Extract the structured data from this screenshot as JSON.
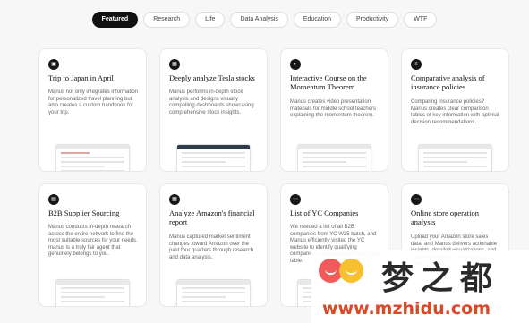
{
  "tabs": [
    {
      "label": "Featured",
      "active": true
    },
    {
      "label": "Research",
      "active": false
    },
    {
      "label": "Life",
      "active": false
    },
    {
      "label": "Data Analysis",
      "active": false
    },
    {
      "label": "Education",
      "active": false
    },
    {
      "label": "Productivity",
      "active": false
    },
    {
      "label": "WTF",
      "active": false
    }
  ],
  "cards": [
    {
      "icon": "suitcase-icon",
      "title": "Trip to Japan in April",
      "description": "Manus not only integrates information for personalized travel planning but also creates a custom handbook for your trip."
    },
    {
      "icon": "image-icon",
      "title": "Deeply analyze Tesla stocks",
      "description": "Manus performs in-depth stock analysis and designs visually compelling dashboards showcasing comprehensive stock insights."
    },
    {
      "icon": "moon-icon",
      "title": "Interactive Course on the Momentum Theorem",
      "description": "Manus creates video presentation materials for middle school teachers explaining the momentum theorem."
    },
    {
      "icon": "document-icon",
      "title": "Comparative analysis of insurance policies",
      "description": "Comparing insurance policies? Manus creates clear comparison tables of key information with optimal decision recommendations."
    },
    {
      "icon": "chart-icon",
      "title": "B2B Supplier Sourcing",
      "description": "Manus conducts in-depth research across the entire network to find the most suitable sources for your needs. manus is a truly fair agent that genuinely belongs to you."
    },
    {
      "icon": "image-icon",
      "title": "Analyze Amazon's financial report",
      "description": "Manus captured market sentiment changes toward Amazon over the past four quarters through research and data analysis."
    },
    {
      "icon": "dots-icon",
      "title": "List of YC Companies",
      "description": "We needed a list of all B2B companies from YC W25 batch, and Manus efficiently visited the YC website to identify qualifying companies and organized them into a table."
    },
    {
      "icon": "dots-icon",
      "title": "Online store operation analysis",
      "description": "Upload your Amazon store sales data, and Manus delivers actionable insights, detailed visualizations, and tailored strategies to boost your sales."
    }
  ],
  "watermark": {
    "text": "梦之都",
    "url": "www.mzhidu.com"
  },
  "colors": {
    "active_tab": "#111111",
    "background": "#f7f7f7",
    "watermark_url": "#d94a2b"
  }
}
